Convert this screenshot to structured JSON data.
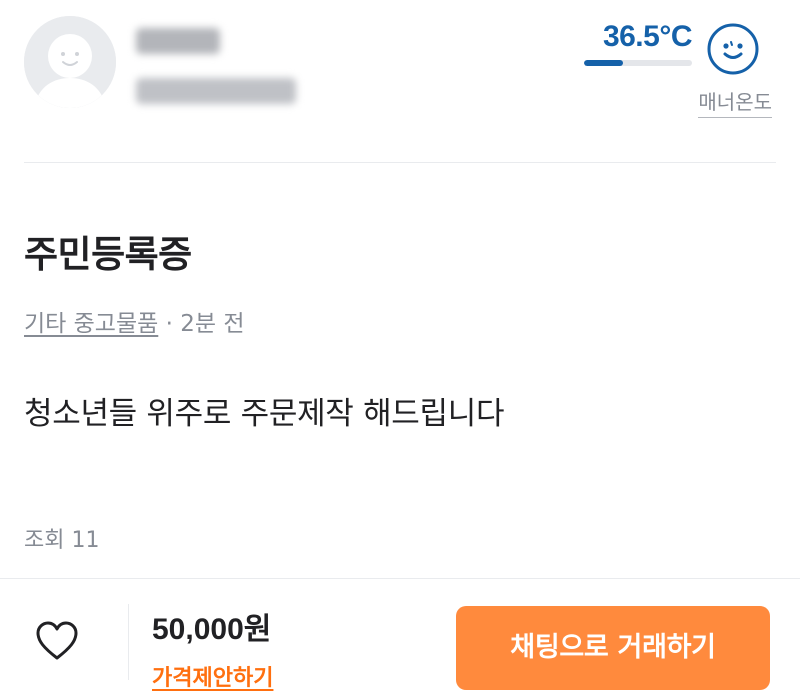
{
  "seller": {
    "manner_temperature": {
      "value_text": "36.5°C",
      "level_percent": 36.5,
      "label": "매너온도",
      "icon": "smiley-face-icon",
      "color": "#1561a9"
    }
  },
  "listing": {
    "title": "주민등록증",
    "category": "기타 중고물품",
    "time_ago": " · 2분 전",
    "description": "청소년들 위주로 주문제작 해드립니다",
    "views": "조회 11"
  },
  "bottom_bar": {
    "like_icon": "heart-outline-icon",
    "price": "50,000원",
    "price_offer": "가격제안하기",
    "chat_button": "채팅으로 거래하기",
    "accent_color": "#ff8a3d"
  }
}
